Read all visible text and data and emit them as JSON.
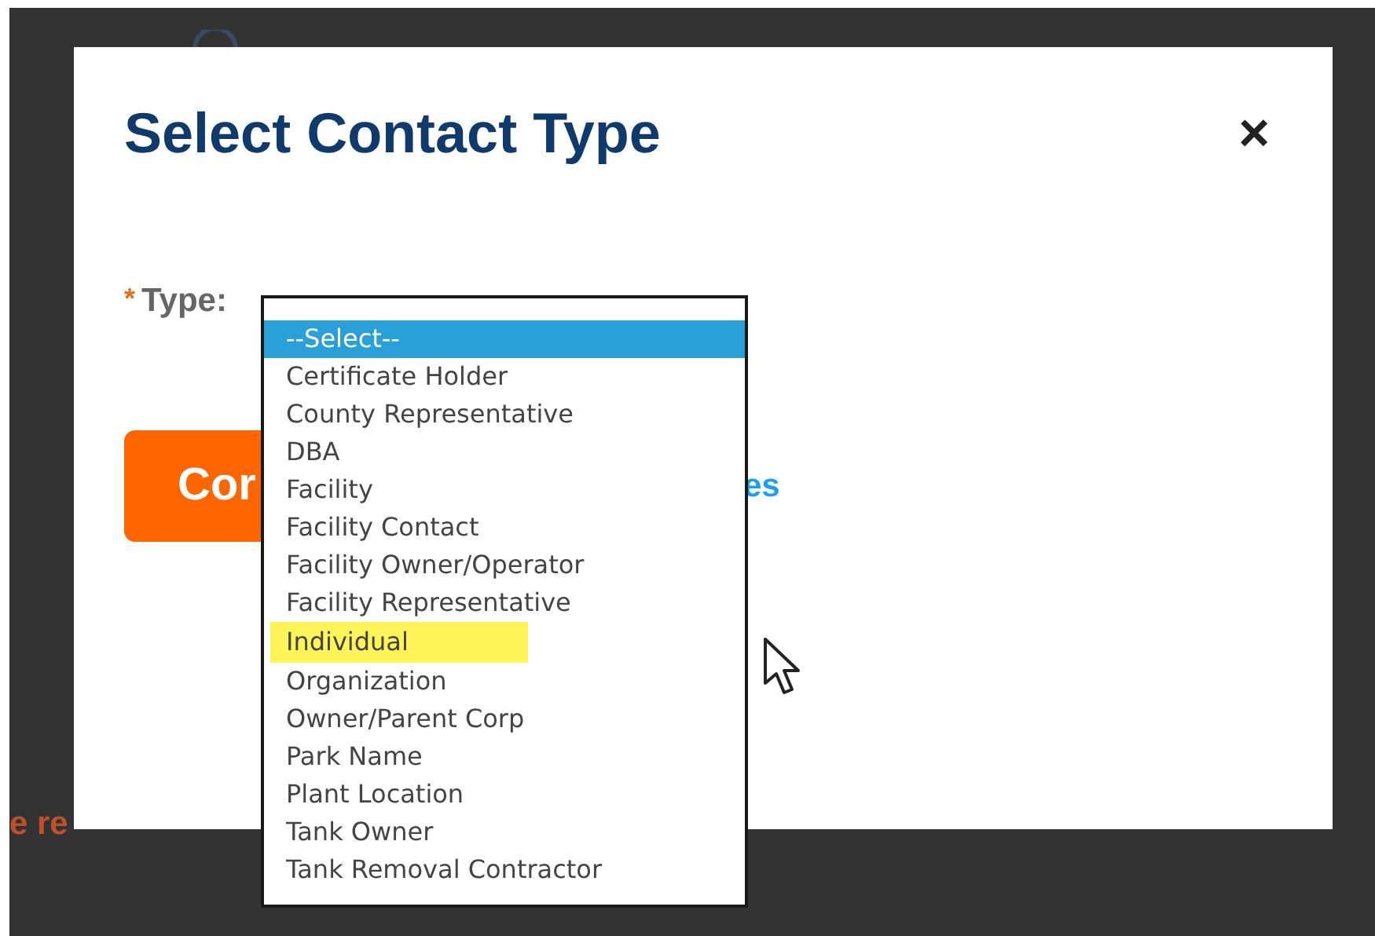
{
  "background": {
    "text_fragment": "e re"
  },
  "dialog": {
    "title": "Select Contact Type",
    "close": "×",
    "field": {
      "label": "Type:",
      "required": true,
      "required_mark": "*"
    },
    "button": "Cor",
    "link": "es"
  },
  "dropdown": {
    "options": [
      {
        "label": "--Select--",
        "selected": true,
        "highlighted": false
      },
      {
        "label": "Certificate Holder",
        "selected": false,
        "highlighted": false
      },
      {
        "label": "County Representative",
        "selected": false,
        "highlighted": false
      },
      {
        "label": "DBA",
        "selected": false,
        "highlighted": false
      },
      {
        "label": "Facility",
        "selected": false,
        "highlighted": false
      },
      {
        "label": "Facility Contact",
        "selected": false,
        "highlighted": false
      },
      {
        "label": "Facility Owner/Operator",
        "selected": false,
        "highlighted": false
      },
      {
        "label": "Facility Representative",
        "selected": false,
        "highlighted": false
      },
      {
        "label": "Individual",
        "selected": false,
        "highlighted": true
      },
      {
        "label": "Organization",
        "selected": false,
        "highlighted": false
      },
      {
        "label": "Owner/Parent Corp",
        "selected": false,
        "highlighted": false
      },
      {
        "label": "Park Name",
        "selected": false,
        "highlighted": false
      },
      {
        "label": "Plant Location",
        "selected": false,
        "highlighted": false
      },
      {
        "label": "Tank Owner",
        "selected": false,
        "highlighted": false
      },
      {
        "label": "Tank Removal Contractor",
        "selected": false,
        "highlighted": false
      }
    ]
  }
}
